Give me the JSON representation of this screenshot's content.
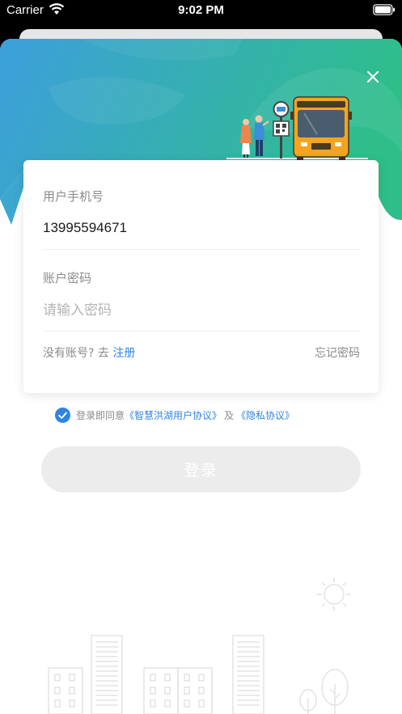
{
  "status_bar": {
    "carrier": "Carrier",
    "time": "9:02 PM"
  },
  "form": {
    "phone_label": "用户手机号",
    "phone_value": "13995594671",
    "password_label": "账户密码",
    "password_placeholder": "请输入密码",
    "no_account_text": "没有账号? 去",
    "register_link": "注册",
    "forgot_password": "忘记密码"
  },
  "agreement": {
    "checked": true,
    "prefix": "登录即同意",
    "user_agreement": "《智慧洪湖用户协议》",
    "conjunction": "及",
    "privacy_policy": "《隐私协议》"
  },
  "login_button": "登录",
  "colors": {
    "header_gradient_start": "#3d9fdc",
    "header_gradient_end": "#2ebe8a",
    "link": "#2f84e0",
    "bus": "#f3a521",
    "button_disabled": "#ececec"
  }
}
